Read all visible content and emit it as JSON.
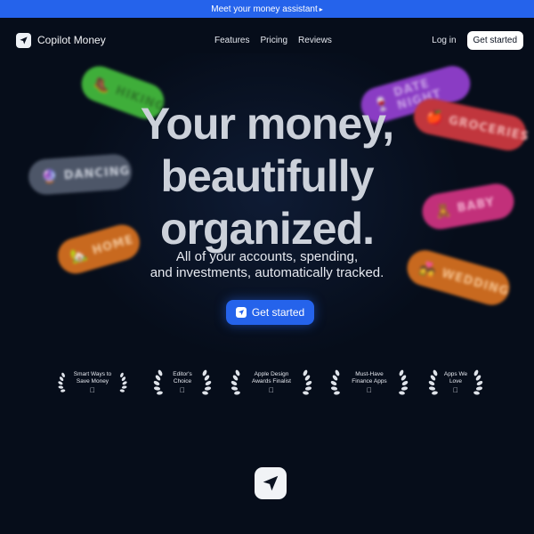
{
  "banner": {
    "text": "Meet your money assistant",
    "arrow": "▸"
  },
  "nav": {
    "logo_icon": "paper-plane-icon",
    "brand": "Copilot Money",
    "links": [
      "Features",
      "Pricing",
      "Reviews"
    ],
    "login": "Log in",
    "cta": "Get started"
  },
  "hero": {
    "headline": [
      "Your money,",
      "beautifully",
      "organized."
    ],
    "subtitle": [
      "All of your accounts, spending,",
      "and investments, automatically tracked."
    ],
    "cta": "Get started",
    "cta_icon": "paper-plane-icon"
  },
  "tags": {
    "hiking": "HIKING",
    "dancing": "DANCING",
    "home": "HOME",
    "date_night": "DATE NIGHT",
    "groceries": "GROCERIES",
    "baby": "BABY",
    "wedding": "WEDDING"
  },
  "awards": [
    {
      "text": "Smart Ways to Save Money"
    },
    {
      "text": "Editor's Choice"
    },
    {
      "text": "Apple Design Awards Finalist"
    },
    {
      "text": "Must-Have Finance Apps"
    },
    {
      "text": "Apps We Love"
    }
  ],
  "colors": {
    "background": "#060d1a",
    "accent": "#2563eb",
    "white": "#ffffff"
  },
  "icons": {
    "award_laurel": "laurel-icon",
    "award_apple": "apple-icon",
    "app": "paper-plane-icon"
  }
}
